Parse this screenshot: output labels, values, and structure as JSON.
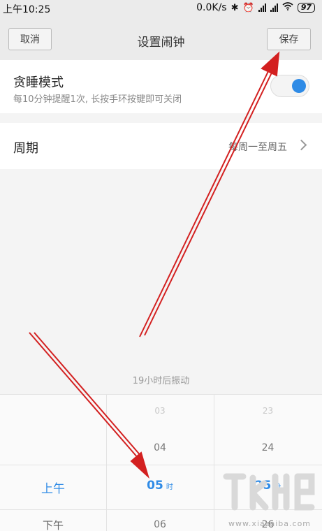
{
  "status_bar": {
    "time": "上午10:25",
    "net_speed": "0.0K/s",
    "battery": "97",
    "icons": [
      "bluetooth-icon",
      "alarm-icon",
      "signal-icon",
      "signal-icon",
      "wifi-icon",
      "battery-icon"
    ]
  },
  "header": {
    "cancel_label": "取消",
    "title": "设置闹钟",
    "save_label": "保存"
  },
  "snooze": {
    "title": "贪睡模式",
    "description": "每10分钟提醒1次, 长按手环按键即可关闭",
    "enabled": true
  },
  "repeat": {
    "label": "周期",
    "value": "每周一至周五"
  },
  "countdown": "19小时后振动",
  "picker": {
    "ampm": {
      "selected": "上午",
      "below": "下午"
    },
    "hours": {
      "above2": "03",
      "above1": "04",
      "selected": "05",
      "below1": "06",
      "unit": "时"
    },
    "minutes": {
      "above2": "23",
      "above1": "24",
      "selected": "25",
      "below1": "26",
      "unit": "分"
    }
  },
  "watermark": {
    "text": "www.xiazaiba.com"
  },
  "colors": {
    "accent": "#2f8be6",
    "annotation": "#d32020"
  }
}
